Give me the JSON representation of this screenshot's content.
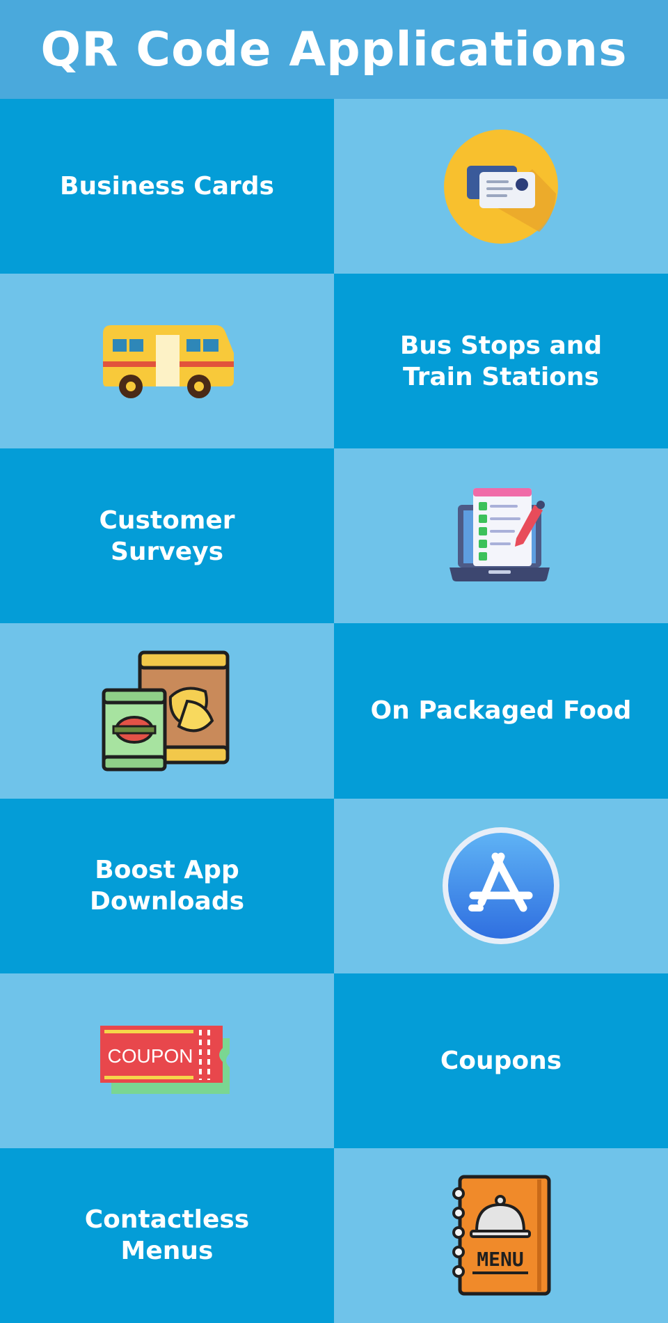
{
  "title": "QR Code Applications",
  "colors": {
    "header": "#4aa9dc",
    "dark_cell": "#049dd7",
    "light_cell": "#6fc3ea",
    "text": "#ffffff"
  },
  "rows": [
    {
      "label": "Business Cards",
      "icon": "business-card-icon"
    },
    {
      "label": "Bus Stops and\nTrain Stations",
      "icon": "bus-icon"
    },
    {
      "label": "Customer\nSurveys",
      "icon": "survey-laptop-icon"
    },
    {
      "label": "On Packaged Food",
      "icon": "packaged-food-icon"
    },
    {
      "label": "Boost App\nDownloads",
      "icon": "app-store-icon"
    },
    {
      "label": "Coupons",
      "icon": "coupon-icon"
    },
    {
      "label": "Contactless\nMenus",
      "icon": "menu-book-icon"
    }
  ],
  "icon_text": {
    "coupon": "COUPON",
    "menu": "MENU"
  }
}
